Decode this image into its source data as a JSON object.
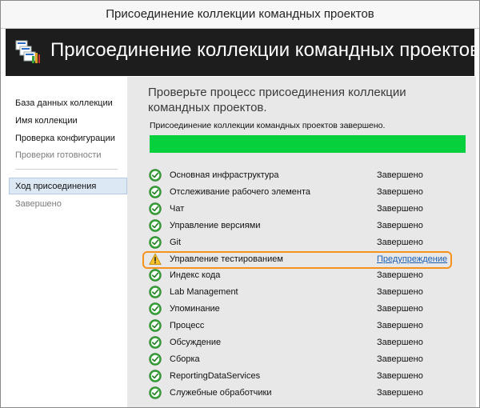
{
  "window": {
    "title": "Присоединение коллекции командных проектов"
  },
  "banner": {
    "title": "Присоединение коллекции командных проектов"
  },
  "sidebar": {
    "items": [
      {
        "label": "База данных коллекции",
        "state": "done"
      },
      {
        "label": "Имя коллекции",
        "state": "done"
      },
      {
        "label": "Проверка конфигурации",
        "state": "done"
      },
      {
        "label": "Проверки готовности",
        "state": "disabled"
      },
      {
        "label": "Ход присоединения",
        "state": "active"
      },
      {
        "label": "Завершено",
        "state": "disabled"
      }
    ]
  },
  "main": {
    "title": "Проверьте процесс присоединения коллекции командных проектов.",
    "status": "Присоединение коллекции командных проектов завершено.",
    "progress_percent": 100,
    "progress_color": "#06d13d",
    "rows": [
      {
        "name": "Основная инфраструктура",
        "status": "Завершено",
        "icon": "check-icon"
      },
      {
        "name": "Отслеживание рабочего элемента",
        "status": "Завершено",
        "icon": "check-icon"
      },
      {
        "name": "Чат",
        "status": "Завершено",
        "icon": "check-icon"
      },
      {
        "name": "Управление версиями",
        "status": "Завершено",
        "icon": "check-icon"
      },
      {
        "name": "Git",
        "status": "Завершено",
        "icon": "check-icon"
      },
      {
        "name": "Управление тестированием",
        "status": "Предупреждение",
        "icon": "warning-icon",
        "link": true
      },
      {
        "name": "Индекс кода",
        "status": "Завершено",
        "icon": "check-icon"
      },
      {
        "name": "Lab Management",
        "status": "Завершено",
        "icon": "check-icon"
      },
      {
        "name": "Упоминание",
        "status": "Завершено",
        "icon": "check-icon"
      },
      {
        "name": "Процесс",
        "status": "Завершено",
        "icon": "check-icon"
      },
      {
        "name": "Обсуждение",
        "status": "Завершено",
        "icon": "check-icon"
      },
      {
        "name": "Сборка",
        "status": "Завершено",
        "icon": "check-icon"
      },
      {
        "name": "ReportingDataServices",
        "status": "Завершено",
        "icon": "check-icon"
      },
      {
        "name": "Служебные обработчики",
        "status": "Завершено",
        "icon": "check-icon"
      }
    ]
  },
  "colors": {
    "highlight": "#f5921e",
    "link": "#1a5fb4",
    "check": "#3aa63a",
    "warning": "#f6c42a"
  }
}
